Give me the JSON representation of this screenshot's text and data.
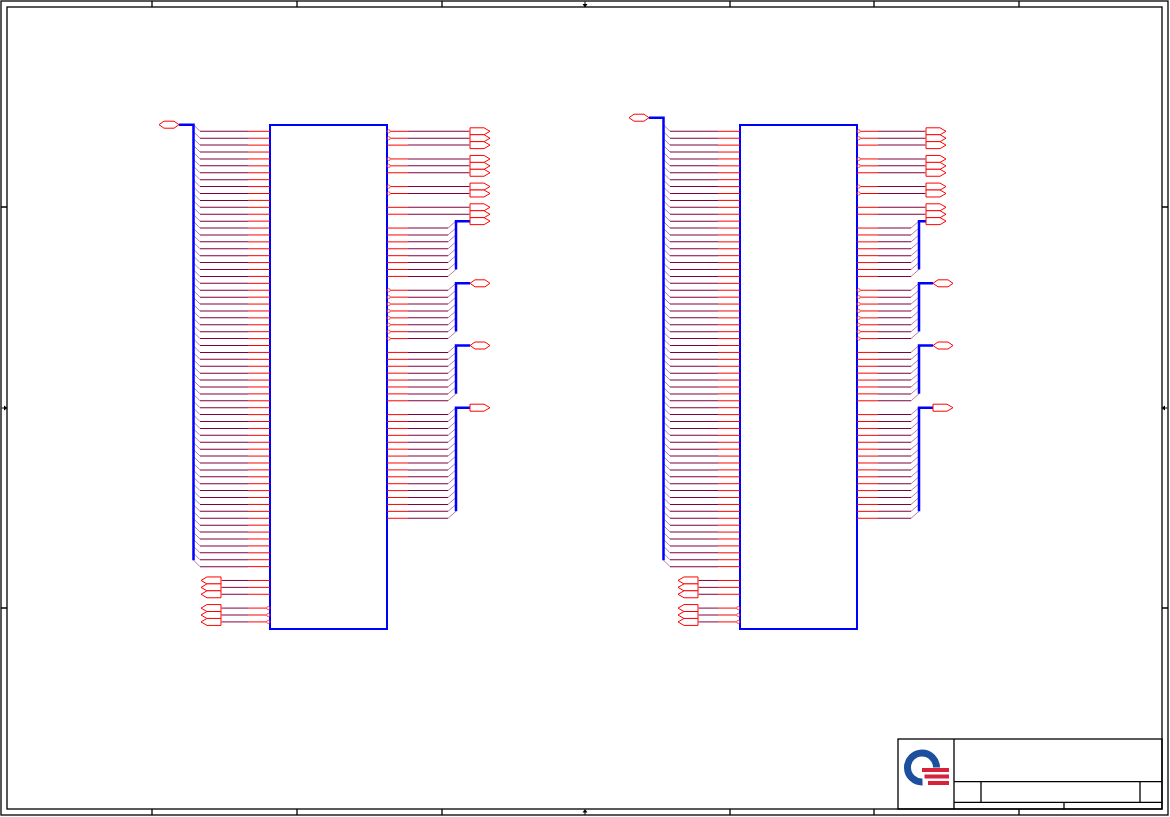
{
  "schematic": {
    "symbols": [
      {
        "left_groups": [
          {
            "kind": "bus",
            "port": {
              "kind": "two_way"
            },
            "pins": [
              {
                "bubble": false
              },
              {
                "bubble": false
              },
              {
                "bubble": false
              },
              {
                "bubble": false
              },
              {
                "bubble": false
              },
              {
                "bubble": false
              },
              {
                "bubble": false
              },
              {
                "bubble": false
              },
              {
                "bubble": false
              },
              {
                "bubble": false
              },
              {
                "bubble": false
              },
              {
                "bubble": false
              },
              {
                "bubble": false
              },
              {
                "bubble": false
              },
              {
                "bubble": false
              },
              {
                "bubble": false
              },
              {
                "bubble": false
              },
              {
                "bubble": false
              },
              {
                "bubble": false
              },
              {
                "bubble": false
              },
              {
                "bubble": false
              },
              {
                "bubble": false
              },
              {
                "bubble": false
              },
              {
                "bubble": false
              },
              {
                "bubble": false
              },
              {
                "bubble": false
              },
              {
                "bubble": false
              },
              {
                "bubble": false
              },
              {
                "bubble": false
              },
              {
                "bubble": false
              },
              {
                "bubble": false
              },
              {
                "bubble": false
              },
              {
                "bubble": false
              },
              {
                "bubble": false
              },
              {
                "bubble": false
              },
              {
                "bubble": false
              },
              {
                "bubble": false
              },
              {
                "bubble": false
              },
              {
                "bubble": false
              },
              {
                "bubble": false
              },
              {
                "bubble": false
              },
              {
                "bubble": false
              },
              {
                "bubble": false
              },
              {
                "bubble": false
              },
              {
                "bubble": false
              },
              {
                "bubble": false
              },
              {
                "bubble": false
              },
              {
                "bubble": false
              },
              {
                "bubble": false
              },
              {
                "bubble": false
              },
              {
                "bubble": false
              },
              {
                "bubble": false
              },
              {
                "bubble": false
              },
              {
                "bubble": false
              },
              {
                "bubble": false
              },
              {
                "bubble": false
              },
              {
                "bubble": false
              },
              {
                "bubble": false
              },
              {
                "bubble": false
              },
              {
                "bubble": false
              },
              {
                "bubble": false
              },
              {
                "bubble": false
              },
              {
                "bubble": false
              },
              {
                "bubble": false
              }
            ]
          },
          {
            "kind": "ports",
            "pins": [
              {
                "kind": "one_way",
                "bubble": false
              },
              {
                "kind": "one_way",
                "bubble": false
              },
              {
                "kind": "one_way",
                "bubble": false
              }
            ]
          },
          {
            "kind": "ports",
            "pins": [
              {
                "kind": "one_way",
                "bubble": true
              },
              {
                "kind": "one_way",
                "bubble": true
              },
              {
                "kind": "one_way",
                "bubble": true
              }
            ]
          }
        ],
        "right_groups": [
          {
            "kind": "ports",
            "pins": [
              {
                "kind": "one_way",
                "bubble": true
              },
              {
                "kind": "one_way",
                "bubble": true
              },
              {
                "kind": "one_way",
                "bubble": false
              }
            ]
          },
          {
            "kind": "ports",
            "pins": [
              {
                "kind": "one_way",
                "bubble": true
              },
              {
                "kind": "one_way",
                "bubble": true
              },
              {
                "kind": "one_way",
                "bubble": false
              }
            ]
          },
          {
            "kind": "ports",
            "pins": [
              {
                "kind": "one_way",
                "bubble": true
              },
              {
                "kind": "one_way",
                "bubble": true
              }
            ]
          },
          {
            "kind": "ports",
            "pins": [
              {
                "kind": "one_way",
                "bubble": false
              },
              {
                "kind": "one_way",
                "bubble": false
              }
            ]
          },
          {
            "kind": "bus",
            "port": {
              "kind": "one_way"
            },
            "pins": [
              {
                "bubble": false
              },
              {
                "bubble": false
              },
              {
                "bubble": false
              },
              {
                "bubble": false
              },
              {
                "bubble": false
              },
              {
                "bubble": false
              },
              {
                "bubble": false
              },
              {
                "bubble": false
              }
            ]
          },
          {
            "kind": "bus",
            "port": {
              "kind": "two_way"
            },
            "pins": [
              {
                "bubble": true
              },
              {
                "bubble": true
              },
              {
                "bubble": true
              },
              {
                "bubble": true
              },
              {
                "bubble": true
              },
              {
                "bubble": true
              },
              {
                "bubble": true
              },
              {
                "bubble": true
              }
            ]
          },
          {
            "kind": "bus",
            "port": {
              "kind": "two_way"
            },
            "pins": [
              {
                "bubble": false
              },
              {
                "bubble": false
              },
              {
                "bubble": false
              },
              {
                "bubble": false
              },
              {
                "bubble": false
              },
              {
                "bubble": false
              },
              {
                "bubble": false
              },
              {
                "bubble": false
              }
            ]
          },
          {
            "kind": "bus",
            "port": {
              "kind": "one_way"
            },
            "pins": [
              {
                "bubble": false
              },
              {
                "bubble": false
              },
              {
                "bubble": false
              },
              {
                "bubble": false
              },
              {
                "bubble": false
              },
              {
                "bubble": false
              },
              {
                "bubble": false
              },
              {
                "bubble": false
              },
              {
                "bubble": false
              },
              {
                "bubble": false
              },
              {
                "bubble": false
              },
              {
                "bubble": false
              },
              {
                "bubble": false
              },
              {
                "bubble": false
              },
              {
                "bubble": false
              },
              {
                "bubble": false
              }
            ]
          }
        ]
      },
      {
        "left_groups": [
          {
            "kind": "bus",
            "port": {
              "kind": "two_way"
            },
            "pins": [
              {
                "bubble": false
              },
              {
                "bubble": false
              },
              {
                "bubble": false
              },
              {
                "bubble": false
              },
              {
                "bubble": false
              },
              {
                "bubble": false
              },
              {
                "bubble": false
              },
              {
                "bubble": false
              },
              {
                "bubble": false
              },
              {
                "bubble": false
              },
              {
                "bubble": false
              },
              {
                "bubble": false
              },
              {
                "bubble": false
              },
              {
                "bubble": false
              },
              {
                "bubble": false
              },
              {
                "bubble": false
              },
              {
                "bubble": false
              },
              {
                "bubble": false
              },
              {
                "bubble": false
              },
              {
                "bubble": false
              },
              {
                "bubble": false
              },
              {
                "bubble": false
              },
              {
                "bubble": false
              },
              {
                "bubble": false
              },
              {
                "bubble": false
              },
              {
                "bubble": false
              },
              {
                "bubble": false
              },
              {
                "bubble": false
              },
              {
                "bubble": false
              },
              {
                "bubble": false
              },
              {
                "bubble": false
              },
              {
                "bubble": false
              },
              {
                "bubble": false
              },
              {
                "bubble": false
              },
              {
                "bubble": false
              },
              {
                "bubble": false
              },
              {
                "bubble": false
              },
              {
                "bubble": false
              },
              {
                "bubble": false
              },
              {
                "bubble": false
              },
              {
                "bubble": false
              },
              {
                "bubble": false
              },
              {
                "bubble": false
              },
              {
                "bubble": false
              },
              {
                "bubble": false
              },
              {
                "bubble": false
              },
              {
                "bubble": false
              },
              {
                "bubble": false
              },
              {
                "bubble": false
              },
              {
                "bubble": false
              },
              {
                "bubble": false
              },
              {
                "bubble": false
              },
              {
                "bubble": false
              },
              {
                "bubble": false
              },
              {
                "bubble": false
              },
              {
                "bubble": false
              },
              {
                "bubble": false
              },
              {
                "bubble": false
              },
              {
                "bubble": false
              },
              {
                "bubble": false
              },
              {
                "bubble": false
              },
              {
                "bubble": false
              },
              {
                "bubble": false
              },
              {
                "bubble": false
              }
            ]
          },
          {
            "kind": "ports",
            "pins": [
              {
                "kind": "one_way",
                "bubble": false
              },
              {
                "kind": "one_way",
                "bubble": false
              },
              {
                "kind": "one_way",
                "bubble": false
              }
            ]
          },
          {
            "kind": "ports",
            "pins": [
              {
                "kind": "one_way",
                "bubble": true
              },
              {
                "kind": "one_way",
                "bubble": true
              },
              {
                "kind": "one_way",
                "bubble": true
              }
            ]
          }
        ],
        "right_groups": [
          {
            "kind": "ports",
            "pins": [
              {
                "kind": "one_way",
                "bubble": true
              },
              {
                "kind": "one_way",
                "bubble": true
              },
              {
                "kind": "one_way",
                "bubble": false
              }
            ]
          },
          {
            "kind": "ports",
            "pins": [
              {
                "kind": "one_way",
                "bubble": true
              },
              {
                "kind": "one_way",
                "bubble": true
              },
              {
                "kind": "one_way",
                "bubble": false
              }
            ]
          },
          {
            "kind": "ports",
            "pins": [
              {
                "kind": "one_way",
                "bubble": true
              },
              {
                "kind": "one_way",
                "bubble": true
              }
            ]
          },
          {
            "kind": "ports",
            "pins": [
              {
                "kind": "one_way",
                "bubble": false
              },
              {
                "kind": "one_way",
                "bubble": false
              }
            ]
          },
          {
            "kind": "bus",
            "port": {
              "kind": "one_way"
            },
            "pins": [
              {
                "bubble": false
              },
              {
                "bubble": false
              },
              {
                "bubble": false
              },
              {
                "bubble": false
              },
              {
                "bubble": false
              },
              {
                "bubble": false
              },
              {
                "bubble": false
              },
              {
                "bubble": false
              }
            ]
          },
          {
            "kind": "bus",
            "port": {
              "kind": "two_way"
            },
            "pins": [
              {
                "bubble": true
              },
              {
                "bubble": true
              },
              {
                "bubble": true
              },
              {
                "bubble": true
              },
              {
                "bubble": true
              },
              {
                "bubble": true
              },
              {
                "bubble": true
              },
              {
                "bubble": true
              }
            ]
          },
          {
            "kind": "bus",
            "port": {
              "kind": "two_way"
            },
            "pins": [
              {
                "bubble": false
              },
              {
                "bubble": false
              },
              {
                "bubble": false
              },
              {
                "bubble": false
              },
              {
                "bubble": false
              },
              {
                "bubble": false
              },
              {
                "bubble": false
              },
              {
                "bubble": false
              }
            ]
          },
          {
            "kind": "bus",
            "port": {
              "kind": "one_way"
            },
            "pins": [
              {
                "bubble": false
              },
              {
                "bubble": false
              },
              {
                "bubble": false
              },
              {
                "bubble": false
              },
              {
                "bubble": false
              },
              {
                "bubble": false
              },
              {
                "bubble": false
              },
              {
                "bubble": false
              },
              {
                "bubble": false
              },
              {
                "bubble": false
              },
              {
                "bubble": false
              },
              {
                "bubble": false
              },
              {
                "bubble": false
              },
              {
                "bubble": false
              },
              {
                "bubble": false
              },
              {
                "bubble": false
              }
            ]
          }
        ]
      }
    ]
  }
}
